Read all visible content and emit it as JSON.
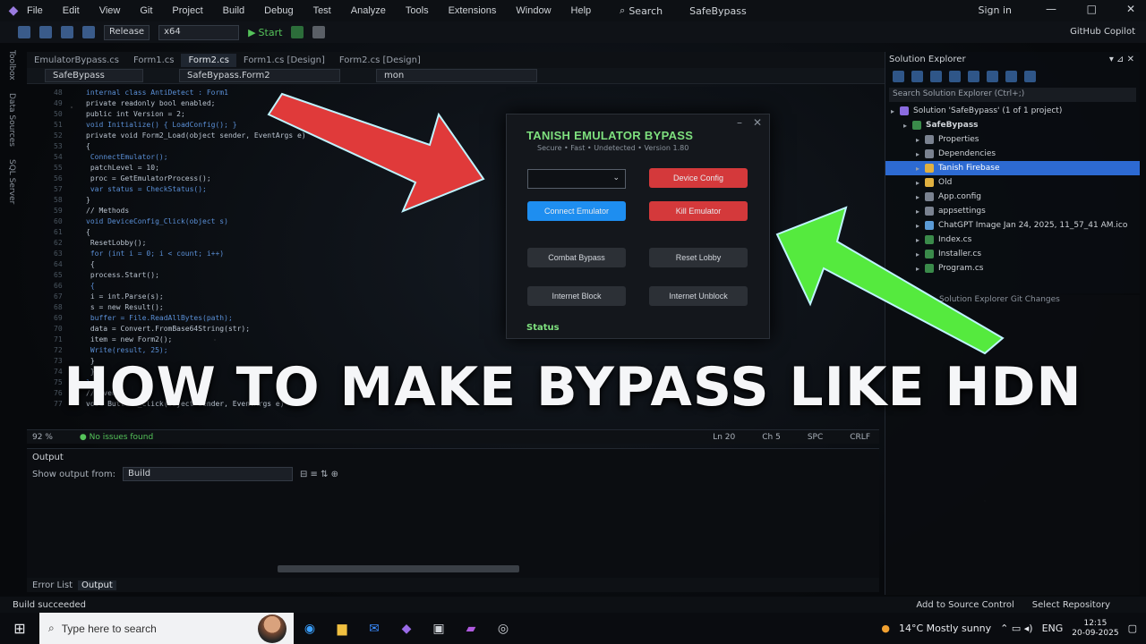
{
  "menu": {
    "items": [
      "File",
      "Edit",
      "View",
      "Git",
      "Project",
      "Build",
      "Debug",
      "Test",
      "Analyze",
      "Tools",
      "Extensions",
      "Window",
      "Help"
    ],
    "search": "Search",
    "app_title": "SafeBypass",
    "sign_in": "Sign in"
  },
  "toolbar": {
    "config": "Release",
    "platform": "x64",
    "start": "Start",
    "copilot": "GitHub Copilot"
  },
  "left_tabs": [
    "Toolbox",
    "Data Sources",
    "SQL Server"
  ],
  "doc_tabs": [
    {
      "label": "EmulatorBypass.cs"
    },
    {
      "label": "Form1.cs"
    },
    {
      "label": "Form2.cs",
      "active": true
    },
    {
      "label": "Form1.cs [Design]"
    },
    {
      "label": "Form2.cs [Design]"
    }
  ],
  "nav": {
    "project": "SafeBypass",
    "class": "SafeBypass.Form2",
    "member": "mon"
  },
  "code_lines": [
    {
      "n": "48",
      "t": "internal class AntiDetect : Form1"
    },
    {
      "n": "49",
      "t": "private readonly bool enabled;"
    },
    {
      "n": "50",
      "t": "public int Version = 2;"
    },
    {
      "n": "51",
      "t": "void Initialize() { LoadConfig(); }"
    },
    {
      "n": "52",
      "t": "private void Form2_Load(object sender, EventArgs e)"
    },
    {
      "n": "53",
      "t": "{"
    },
    {
      "n": "54",
      "t": "   ConnectEmulator();"
    },
    {
      "n": "55",
      "t": "   patchLevel = 10;"
    },
    {
      "n": "56",
      "t": "   proc = GetEmulatorProcess();"
    },
    {
      "n": "57",
      "t": "   var status = CheckStatus();"
    },
    {
      "n": "58",
      "t": "}"
    },
    {
      "n": "59",
      "t": "// Methods"
    },
    {
      "n": "60",
      "t": "void DeviceConfig_Click(object s)"
    },
    {
      "n": "61",
      "t": "{"
    },
    {
      "n": "62",
      "t": "   ResetLobby();"
    },
    {
      "n": "63",
      "t": "   for (int i = 0; i < count; i++)"
    },
    {
      "n": "64",
      "t": "   {"
    },
    {
      "n": "65",
      "t": "      process.Start();"
    },
    {
      "n": "66",
      "t": "      {"
    },
    {
      "n": "67",
      "t": "         i = int.Parse(s);"
    },
    {
      "n": "68",
      "t": "         s = new Result();"
    },
    {
      "n": "69",
      "t": "         buffer = File.ReadAllBytes(path);"
    },
    {
      "n": "70",
      "t": "         data = Convert.FromBase64String(str);"
    },
    {
      "n": "71",
      "t": "         item = new Form2();"
    },
    {
      "n": "72",
      "t": "         Write(result, 25);"
    },
    {
      "n": "73",
      "t": "      }"
    },
    {
      "n": "74",
      "t": "   }"
    },
    {
      "n": "75",
      "t": "}"
    },
    {
      "n": "76",
      "t": "// Events"
    },
    {
      "n": "77",
      "t": "void Button1_Click(object sender, EventArgs e)"
    }
  ],
  "editor_status": {
    "zoom": "92 %",
    "issues": "No issues found",
    "position": "Ln 20",
    "col": "Ch 5",
    "spc": "SPC",
    "crlf": "CRLF"
  },
  "dialog": {
    "title": "TANISH EMULATOR BYPASS",
    "subtitle": "Secure • Fast • Undetected • Version 1.80",
    "combo_arrow": "⌄",
    "buttons": {
      "device_config": "Device Config",
      "connect_emulator": "Connect Emulator",
      "kill_emulator": "Kill Emulator",
      "combat_bypass": "Combat Bypass",
      "reset_lobby": "Reset Lobby",
      "internet_block": "Internet Block",
      "internet_unblock": "Internet Unblock"
    },
    "status": "Status"
  },
  "caption": "HOW TO MAKE BYPASS LIKE HDN",
  "output": {
    "title": "Output",
    "show_label": "Show output from:",
    "show_value": "Build",
    "tabs": [
      "Error List",
      "Output"
    ]
  },
  "solution": {
    "title": "Solution Explorer",
    "search": "Search Solution Explorer (Ctrl+;)",
    "tree": [
      {
        "label": "Solution 'SafeBypass' (1 of 1 project)",
        "indent": 0
      },
      {
        "label": "SafeBypass",
        "indent": 1,
        "bold": true
      },
      {
        "label": "Properties",
        "indent": 2
      },
      {
        "label": "Dependencies",
        "indent": 2
      },
      {
        "label": "Tanish Firebase",
        "indent": 2,
        "selected": true
      },
      {
        "label": "Old",
        "indent": 2
      },
      {
        "label": "App.config",
        "indent": 2
      },
      {
        "label": "appsettings",
        "indent": 2
      },
      {
        "label": "ChatGPT Image Jan 24, 2025, 11_57_41 AM.ico",
        "indent": 2
      },
      {
        "label": "Index.cs",
        "indent": 2
      },
      {
        "label": "Installer.cs",
        "indent": 2
      },
      {
        "label": "Program.cs",
        "indent": 2
      }
    ],
    "bottom_tabs": "Solution Explorer   Git Changes"
  },
  "vs_status": {
    "left": "Build succeeded",
    "source_control": "Add to Source Control",
    "repo": "Select Repository"
  },
  "taskbar": {
    "search_placeholder": "Type here to search",
    "weather": "14°C  Mostly sunny",
    "lang": "ENG",
    "time": "12:15",
    "date": "20-09-2025"
  },
  "colors": {
    "accent_green": "#7ee07e",
    "red_button": "#d4393b",
    "blue_button": "#1e8ef0",
    "arrow_red": "#e03a3a",
    "arrow_green": "#55ea3e"
  }
}
